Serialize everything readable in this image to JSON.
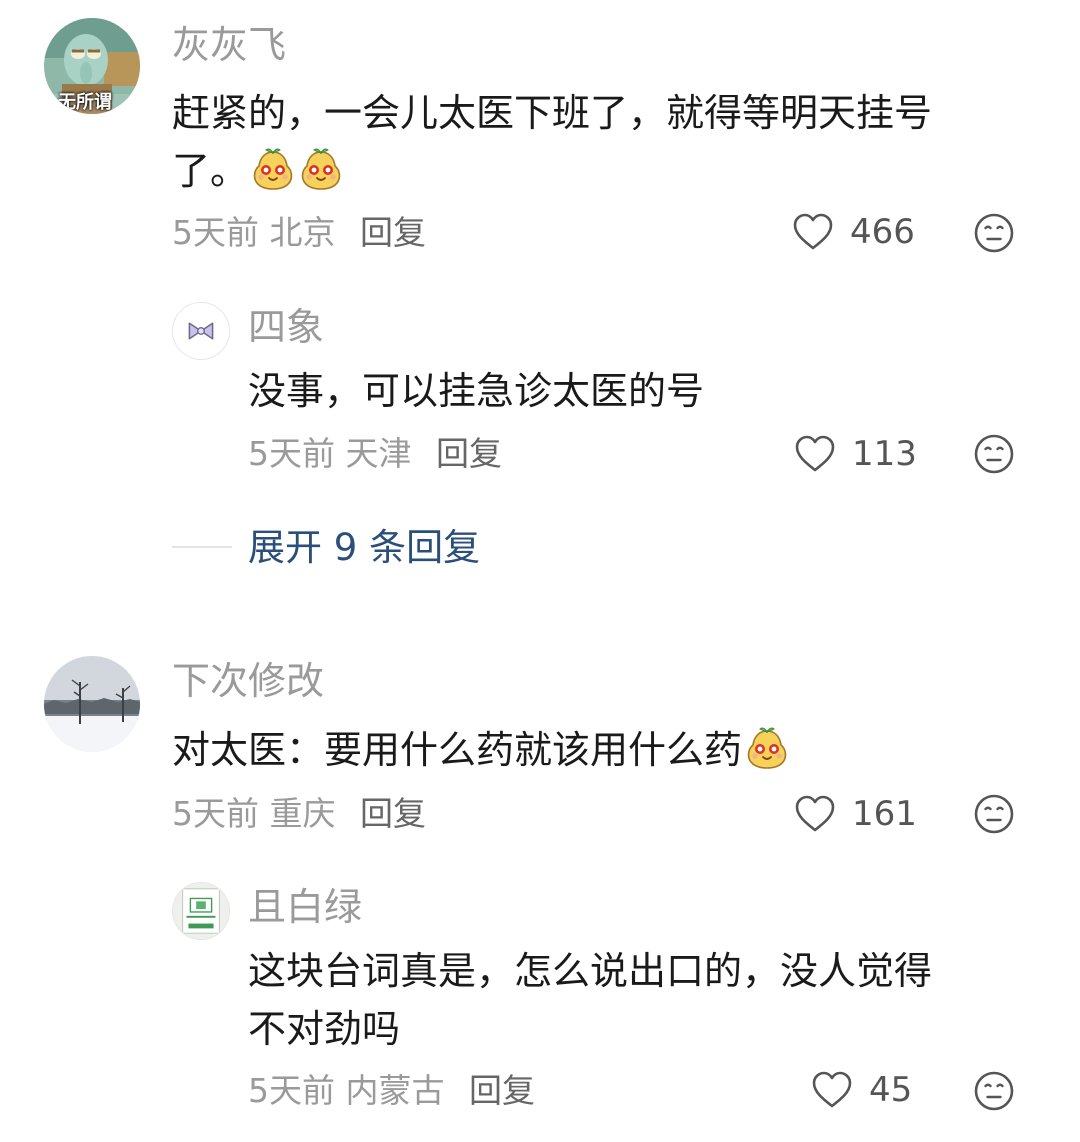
{
  "colors": {
    "username": "#9a9a9a",
    "content": "#1a1a1a",
    "meta": "#9a9a9a",
    "expand_link": "#2a4f7a"
  },
  "comments": [
    {
      "username": "灰灰飞",
      "avatar_icon": "squidward-avatar",
      "avatar_text": "无所谓",
      "content_line1": "赶紧的，一会儿太医下班了，就得等明天挂号",
      "content_line2": "了。",
      "emoji_icons": [
        "pear-face-emoji",
        "pear-face-emoji"
      ],
      "time": "5天前",
      "location": "北京",
      "reply_label": "回复",
      "likes": "466",
      "replies": [
        {
          "username": "四象",
          "avatar_icon": "bow-avatar",
          "content": "没事，可以挂急诊太医的号",
          "time": "5天前",
          "location": "天津",
          "reply_label": "回复",
          "likes": "113"
        }
      ],
      "expand_label": "展开 9 条回复"
    },
    {
      "username": "下次修改",
      "avatar_icon": "snow-landscape-avatar",
      "content": "对太医：要用什么药就该用什么药",
      "emoji_icons": [
        "pear-face-emoji"
      ],
      "time": "5天前",
      "location": "重庆",
      "reply_label": "回复",
      "likes": "161",
      "replies": [
        {
          "username": "且白绿",
          "avatar_icon": "sign-photo-avatar",
          "content_line1": "这块台词真是，怎么说出口的，没人觉得",
          "content_line2": "不对劲吗",
          "time": "5天前",
          "location": "内蒙古",
          "reply_label": "回复",
          "likes": "45"
        }
      ]
    }
  ]
}
